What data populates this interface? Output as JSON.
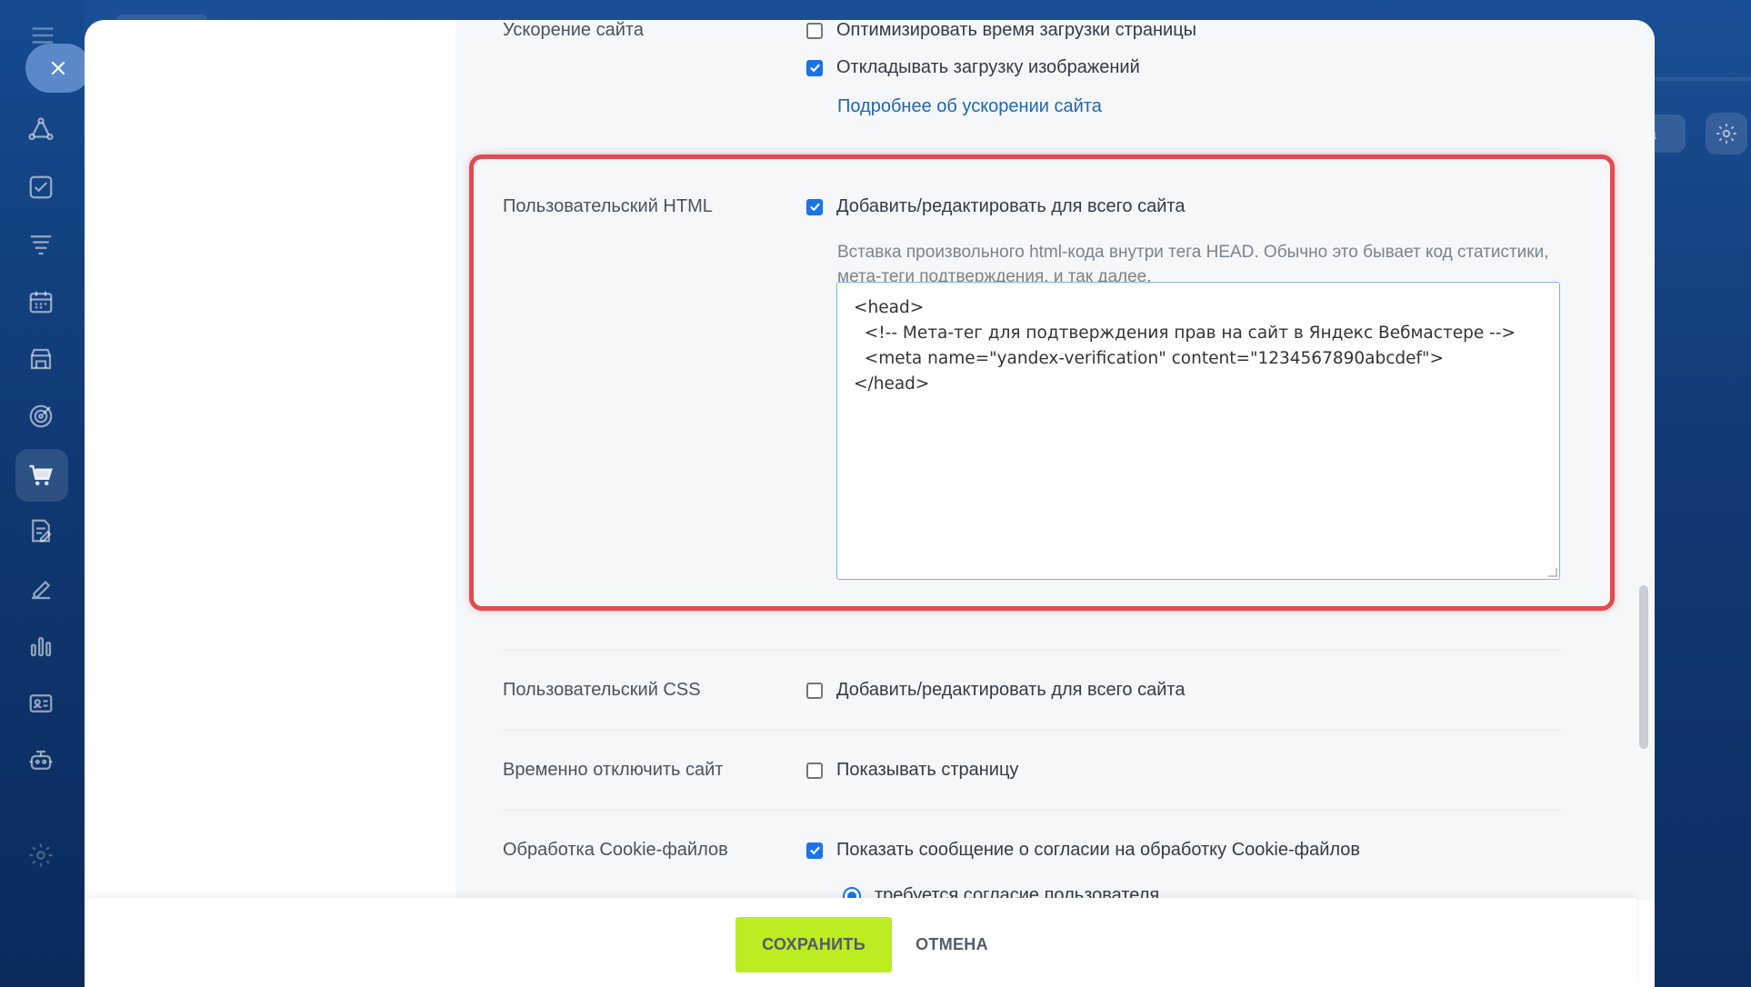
{
  "sidebar": {
    "close_icon": "close-icon",
    "items": [
      {
        "icon": "crm-icon"
      },
      {
        "icon": "tasks-icon"
      },
      {
        "icon": "funnel-icon"
      },
      {
        "icon": "calendar-icon"
      },
      {
        "icon": "store-icon"
      },
      {
        "icon": "target-icon"
      },
      {
        "icon": "cart-icon",
        "active": true
      },
      {
        "icon": "document-sign-icon"
      },
      {
        "icon": "edit-icon"
      },
      {
        "icon": "analytics-icon"
      },
      {
        "icon": "contact-card-icon"
      },
      {
        "icon": "robot-icon"
      },
      {
        "icon": "settings-icon"
      }
    ]
  },
  "background": {
    "partial_button": "на"
  },
  "settings": {
    "speed": {
      "label": "Ускорение сайта",
      "optimize_label": "Оптимизировать время загрузки страницы",
      "optimize_checked": false,
      "lazy_label": "Откладывать загрузку изображений",
      "lazy_checked": true,
      "more_link": "Подробнее об ускорении сайта"
    },
    "custom_html": {
      "label": "Пользовательский HTML",
      "option_label": "Добавить/редактировать для всего сайта",
      "checked": true,
      "hint": "Вставка произвольного html-кода внутри тега HEAD. Обычно это бывает код статистики, мета-теги подтверждения, и так далее.",
      "code": "<head>\n  <!-- Мета-тег для подтверждения прав на сайт в Яндекс Вебмастере -->\n  <meta name=\"yandex-verification\" content=\"1234567890abcdef\">\n</head>"
    },
    "custom_css": {
      "label": "Пользовательский CSS",
      "option_label": "Добавить/редактировать для всего сайта",
      "checked": false
    },
    "disable_site": {
      "label": "Временно отключить сайт",
      "option_label": "Показывать страницу",
      "checked": false
    },
    "cookies": {
      "label": "Обработка Cookie-файлов",
      "option_label": "Показать сообщение о согласии на обработку Cookie-файлов",
      "checked": true,
      "radio_label": "требуется согласие пользователя",
      "radio_selected": true
    }
  },
  "footer": {
    "save_label": "СОХРАНИТЬ",
    "cancel_label": "ОТМЕНА"
  },
  "colors": {
    "accent": "#1a73e8",
    "save_button": "#bbed21",
    "highlight_border": "#e24b4f",
    "link": "#2067b0"
  }
}
